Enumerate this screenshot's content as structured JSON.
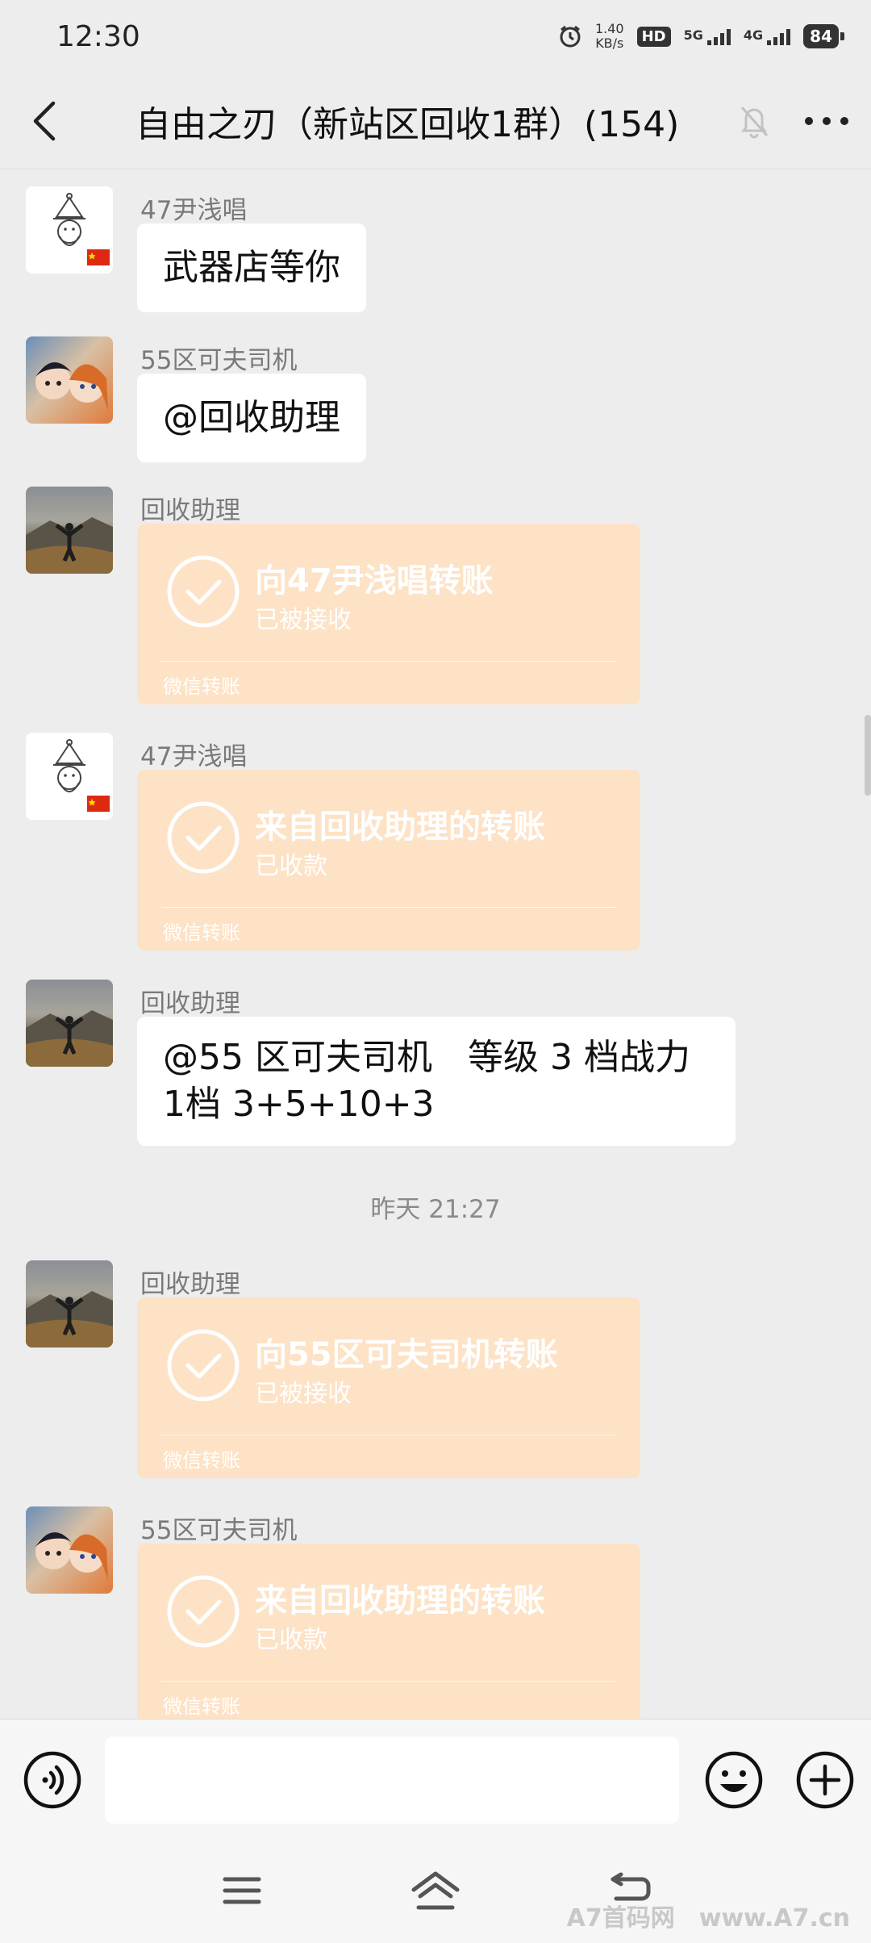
{
  "status_bar": {
    "time": "12:30",
    "net_speed_value": "1.40",
    "net_speed_unit": "KB/s",
    "hd_label": "HD",
    "signal_1": "5G",
    "signal_2": "4G",
    "battery": "84"
  },
  "header": {
    "title": "自由之刃（新站区回收1群）(154)",
    "icons": [
      "back-arrow-icon",
      "bell-muted-icon",
      "more-dots-icon"
    ]
  },
  "messages": [
    {
      "sender": "47尹浅唱",
      "type": "text",
      "text": "武器店等你",
      "avatar": "drawing"
    },
    {
      "sender": "55区可夫司机",
      "type": "text",
      "text": "@回收助理",
      "avatar": "anime"
    },
    {
      "sender": "回收助理",
      "type": "transfer",
      "title": "向47尹浅唱转账",
      "status": "已被接收",
      "footer": "微信转账",
      "avatar": "mountain"
    },
    {
      "sender": "47尹浅唱",
      "type": "transfer",
      "title": "来自回收助理的转账",
      "status": "已收款",
      "footer": "微信转账",
      "avatar": "drawing"
    },
    {
      "sender": "回收助理",
      "type": "text",
      "line1": "@55 区可夫司机　等级 3 档战力",
      "line2": "1档 3+5+10+3",
      "avatar": "mountain"
    },
    {
      "sender": "回收助理",
      "type": "transfer",
      "title": "向55区可夫司机转账",
      "status": "已被接收",
      "footer": "微信转账",
      "avatar": "mountain"
    },
    {
      "sender": "55区可夫司机",
      "type": "transfer",
      "title": "来自回收助理的转账",
      "status": "已收款",
      "footer": "微信转账",
      "avatar": "anime"
    }
  ],
  "timestamp": "昨天 21:27",
  "input_bar": {
    "value": "",
    "icons": [
      "voice-icon",
      "emoji-icon",
      "plus-icon"
    ]
  },
  "nav_bar": {
    "icons": [
      "menu-icon",
      "home-icon",
      "back-icon"
    ]
  },
  "watermark": "A7首码网　www.A7.cn",
  "colors": {
    "transfer_bg": "#fde2c6",
    "chat_bg": "#ededed",
    "bubble_bg": "#ffffff"
  }
}
